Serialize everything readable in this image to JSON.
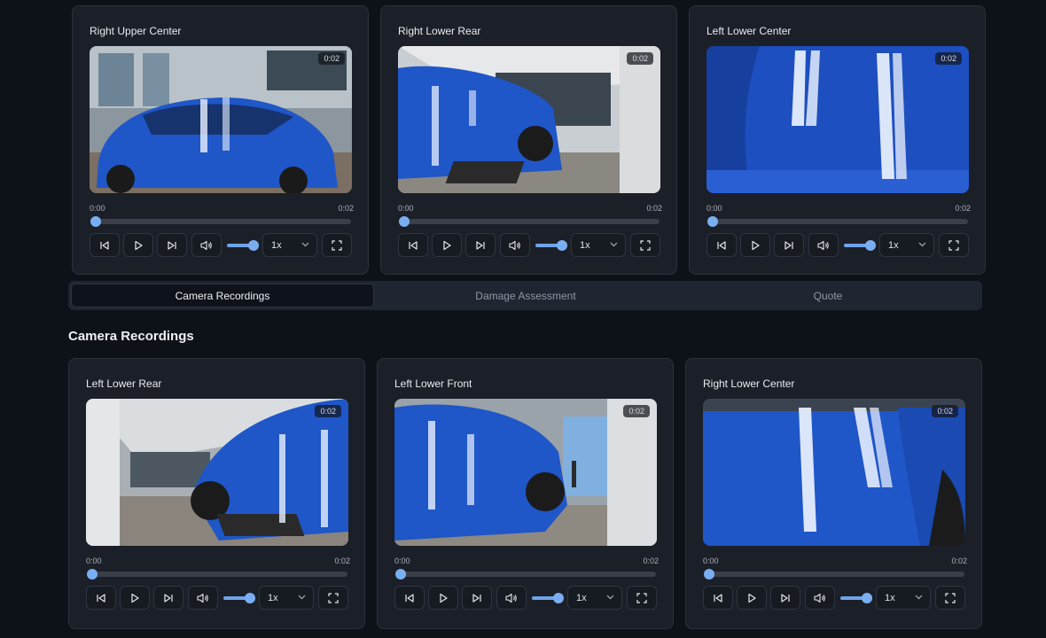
{
  "tabs": [
    {
      "label": "Camera Recordings",
      "active": true
    },
    {
      "label": "Damage Assessment",
      "active": false
    },
    {
      "label": "Quote",
      "active": false
    }
  ],
  "section_title": "Camera Recordings",
  "players": [
    {
      "title": "Right Upper Center",
      "duration_badge": "0:02",
      "current_time": "0:00",
      "total_time": "0:02",
      "speed": "1x",
      "progress": 0,
      "volume": 1
    },
    {
      "title": "Right Lower Rear",
      "duration_badge": "0:02",
      "current_time": "0:00",
      "total_time": "0:02",
      "speed": "1x",
      "progress": 0,
      "volume": 1
    },
    {
      "title": "Left Lower Center",
      "duration_badge": "0:02",
      "current_time": "0:00",
      "total_time": "0:02",
      "speed": "1x",
      "progress": 0,
      "volume": 1
    },
    {
      "title": "Left Lower Rear",
      "duration_badge": "0:02",
      "current_time": "0:00",
      "total_time": "0:02",
      "speed": "1x",
      "progress": 0,
      "volume": 1
    },
    {
      "title": "Left Lower Front",
      "duration_badge": "0:02",
      "current_time": "0:00",
      "total_time": "0:02",
      "speed": "1x",
      "progress": 0,
      "volume": 1
    },
    {
      "title": "Right Lower Center",
      "duration_badge": "0:02",
      "current_time": "0:00",
      "total_time": "0:02",
      "speed": "1x",
      "progress": 0,
      "volume": 1
    }
  ],
  "colors": {
    "accent": "#7aaef2",
    "car_blue": "#1f56c8",
    "card_bg": "#1b1f27",
    "page_bg": "#0d1118"
  },
  "icons": [
    "skip-back-icon",
    "play-icon",
    "skip-forward-icon",
    "volume-icon",
    "chevron-down-icon",
    "fullscreen-icon"
  ]
}
